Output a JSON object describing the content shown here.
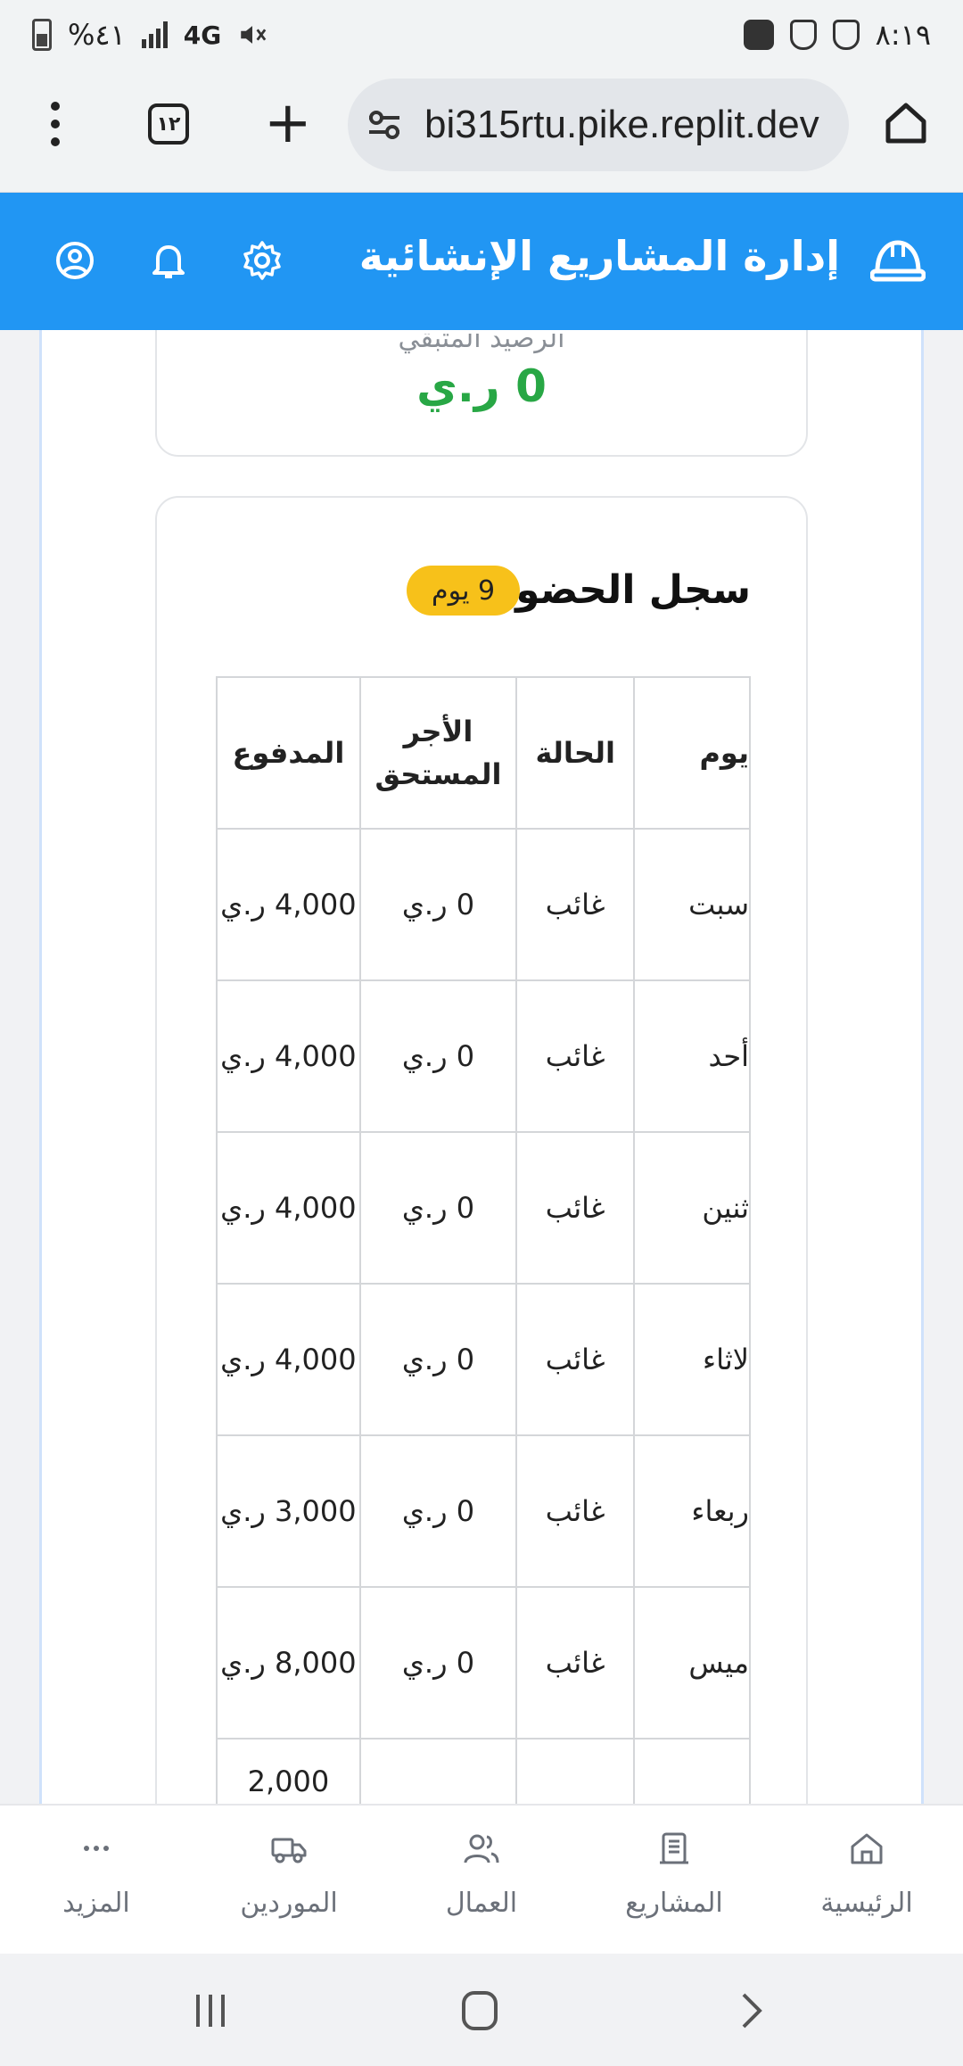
{
  "status_bar": {
    "time": "٨:١٩",
    "battery": "%٤١",
    "network": "4G"
  },
  "browser": {
    "url": "bi315rtu.pike.replit.dev",
    "tabs_count": "١٢"
  },
  "header": {
    "title": "إدارة المشاريع الإنشائية"
  },
  "balance": {
    "label": "الرصيد المتبقي",
    "value": "0 ر.ي"
  },
  "attendance": {
    "title": "سجل الحضور",
    "badge": "9 يوم",
    "columns": [
      "يوم",
      "الحالة",
      "الأجر المستحق",
      "المدفوع"
    ],
    "rows": [
      {
        "day": "سبت",
        "status": "غائب",
        "due": "0 ر.ي",
        "paid": "4,000 ر.ي"
      },
      {
        "day": "أحد",
        "status": "غائب",
        "due": "0 ر.ي",
        "paid": "4,000 ر.ي"
      },
      {
        "day": "ثنين",
        "status": "غائب",
        "due": "0 ر.ي",
        "paid": "4,000 ر.ي"
      },
      {
        "day": "لاثاء",
        "status": "غائب",
        "due": "0 ر.ي",
        "paid": "4,000 ر.ي"
      },
      {
        "day": "ربعاء",
        "status": "غائب",
        "due": "0 ر.ي",
        "paid": "3,000 ر.ي"
      },
      {
        "day": "ميس",
        "status": "غائب",
        "due": "0 ر.ي",
        "paid": "8,000 ر.ي"
      },
      {
        "day": "",
        "status": "",
        "due": "",
        "paid": "2,000"
      }
    ]
  },
  "bottom_nav": {
    "items": [
      {
        "label": "الرئيسية",
        "icon": "home-icon"
      },
      {
        "label": "المشاريع",
        "icon": "building-icon"
      },
      {
        "label": "العمال",
        "icon": "users-icon"
      },
      {
        "label": "الموردين",
        "icon": "truck-icon"
      },
      {
        "label": "المزيد",
        "icon": "more-icon"
      }
    ]
  },
  "colors": {
    "primary": "#2196f3",
    "success": "#28a745",
    "badge": "#f7c11a"
  }
}
